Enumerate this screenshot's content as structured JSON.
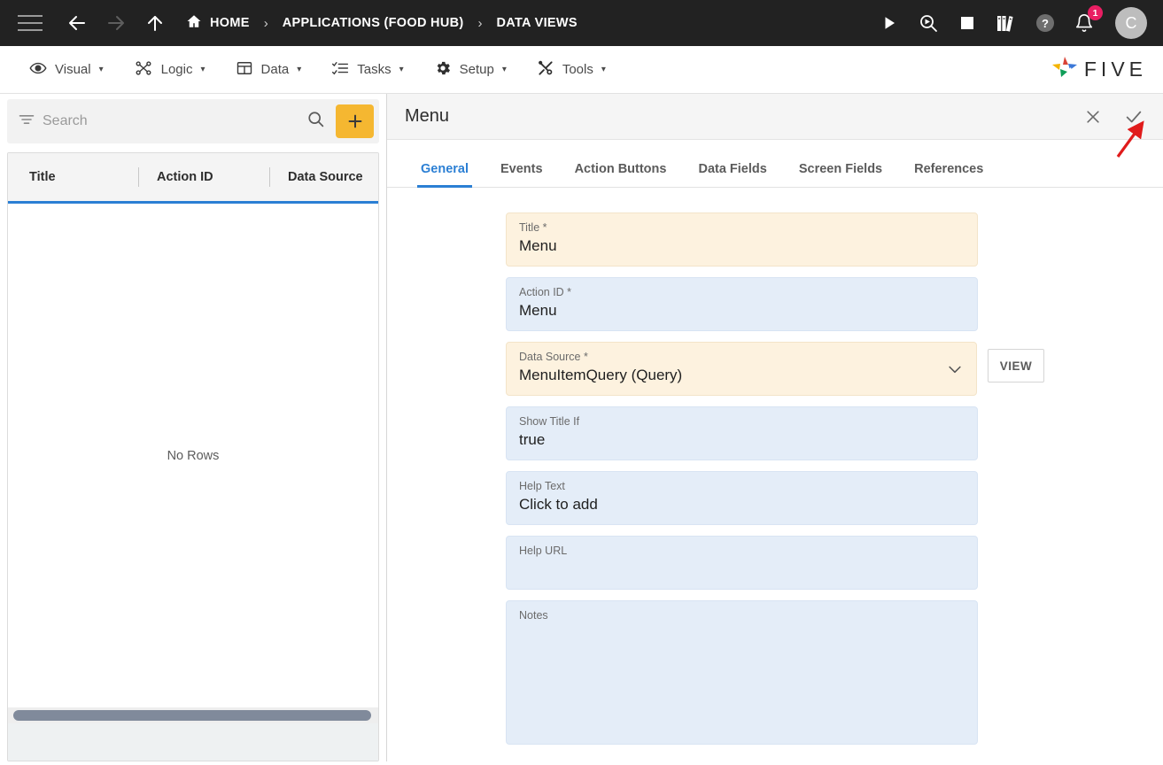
{
  "topbar": {
    "menu_icon": "hamburger-icon",
    "back_icon": "arrow-left-icon",
    "forward_icon": "arrow-right-icon",
    "up_icon": "arrow-up-icon",
    "breadcrumbs": [
      {
        "label": "HOME",
        "icon": "home-icon"
      },
      {
        "label": "APPLICATIONS (FOOD HUB)"
      },
      {
        "label": "DATA VIEWS"
      }
    ],
    "separator": "›",
    "actions": [
      {
        "name": "run-icon",
        "title": "Run"
      },
      {
        "name": "debug-icon",
        "title": "Debug"
      },
      {
        "name": "stop-icon",
        "title": "Stop"
      },
      {
        "name": "library-icon",
        "title": "Library"
      },
      {
        "name": "help-icon",
        "title": "Help"
      },
      {
        "name": "notification-bell-icon",
        "title": "Notifications"
      }
    ],
    "notification_count": "1",
    "avatar_initial": "C"
  },
  "menubar": {
    "items": [
      {
        "label": "Visual",
        "icon": "eye-icon"
      },
      {
        "label": "Logic",
        "icon": "logic-nodes-icon"
      },
      {
        "label": "Data",
        "icon": "table-icon"
      },
      {
        "label": "Tasks",
        "icon": "task-list-icon"
      },
      {
        "label": "Setup",
        "icon": "gear-icon"
      },
      {
        "label": "Tools",
        "icon": "tools-icon"
      }
    ],
    "caret": "▾",
    "brand": "FIVE"
  },
  "left_panel": {
    "search": {
      "placeholder": "Search",
      "value": ""
    },
    "filter_icon": "filter-icon",
    "search_icon": "search-icon",
    "add_button_label": "+",
    "columns": [
      "Title",
      "Action ID",
      "Data Source"
    ],
    "empty_message": "No Rows"
  },
  "right_panel": {
    "title": "Menu",
    "close_label": "✕",
    "save_label": "✓",
    "tabs": [
      {
        "label": "General",
        "active": true
      },
      {
        "label": "Events",
        "active": false
      },
      {
        "label": "Action Buttons",
        "active": false
      },
      {
        "label": "Data Fields",
        "active": false
      },
      {
        "label": "Screen Fields",
        "active": false
      },
      {
        "label": "References",
        "active": false
      }
    ],
    "fields": {
      "title": {
        "label": "Title *",
        "value": "Menu"
      },
      "action_id": {
        "label": "Action ID *",
        "value": "Menu"
      },
      "data_source": {
        "label": "Data Source *",
        "value": "MenuItemQuery (Query)",
        "view_button": "VIEW"
      },
      "show_title_if": {
        "label": "Show Title If",
        "value": "true"
      },
      "help_text": {
        "label": "Help Text",
        "value": "Click to add"
      },
      "help_url": {
        "label": "Help URL",
        "value": ""
      },
      "notes": {
        "label": "Notes",
        "value": ""
      }
    }
  },
  "colors": {
    "header_bg": "#222222",
    "accent_orange": "#F5B731",
    "active_blue": "#2B7FD4",
    "cream_field": "#FDF2DF",
    "blue_field": "#E4EDF8",
    "badge_pink": "#E91E63",
    "annotation_red": "#E01B1B"
  }
}
